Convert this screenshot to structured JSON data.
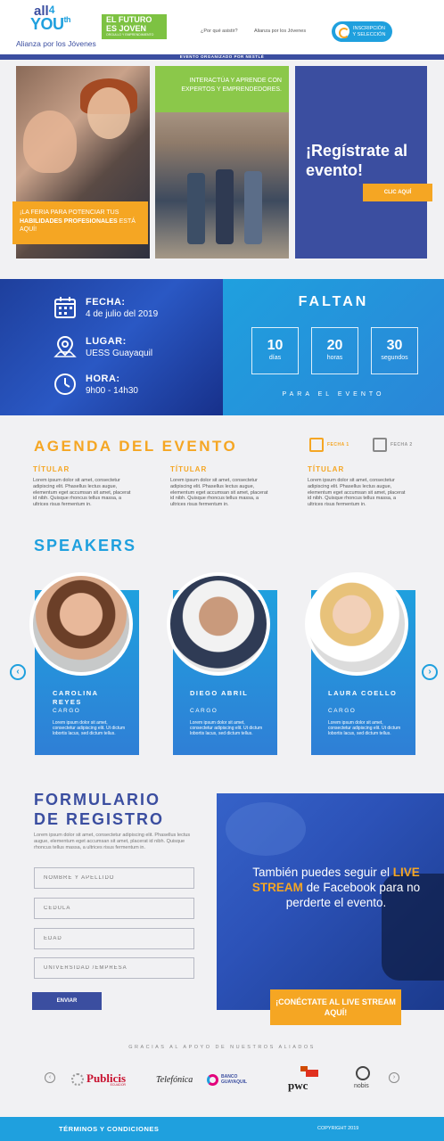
{
  "header": {
    "logo_all": "all",
    "logo_4": "4",
    "logo_you": "YOU",
    "logo_th": "th",
    "logo_tagline": "Alianza por los Jóvenes",
    "efej_line1": "EL FUTURO",
    "efej_line2": "ES JOVEN",
    "efej_line3": "ORGULLO Y EMPRENDIMIENTO",
    "nav": [
      "¿Por qué asistir?",
      "Alianza por los Jóvenes"
    ],
    "cta_label": "INSCRIPCIÓN Y SELECCIÓN",
    "topbar_text": "EVENTO ORGANIZADO POR NESTLÉ"
  },
  "hero": {
    "orange_text_pre": "¡LA FERIA PARA POTENCIAR TUS ",
    "orange_text_bold": "HABILIDADES PROFESIONALES",
    "orange_text_post": " ESTÁ AQUÍ!",
    "green_text": "INTERACTÚA Y APRENDE CON EXPERTOS Y EMPRENDEDORES.",
    "register_title": "¡Regístrate al evento!",
    "register_button": "CLIC AQUÍ"
  },
  "event_info": {
    "fecha_label": "FECHA:",
    "fecha_value": "4 de julio del 2019",
    "lugar_label": "LUGAR:",
    "lugar_value": "UESS Guayaquil",
    "hora_label": "HORA:",
    "hora_value": "9h00 - 14h30"
  },
  "countdown": {
    "title": "FALTAN",
    "units": [
      {
        "value": "10",
        "label": "días"
      },
      {
        "value": "20",
        "label": "horas"
      },
      {
        "value": "30",
        "label": "segundos"
      }
    ],
    "subtitle": "PARA EL EVENTO"
  },
  "agenda": {
    "title": "AGENDA DEL EVENTO",
    "tabs": [
      "FECHA 1",
      "FECHA 2"
    ],
    "columns": [
      {
        "heading": "TÍTULAR",
        "text": "Lorem ipsum dolor sit amet, consectetur adipiscing elit. Phasellus lectus augue, elementum eget accumsan sit amet, placerat id nibh. Quisque rhoncus tellus massa, a ultrices risus fermentum in."
      },
      {
        "heading": "TÍTULAR",
        "text": "Lorem ipsum dolor sit amet, consectetur adipiscing elit. Phasellus lectus augue, elementum eget accumsan sit amet, placerat id nibh. Quisque rhoncus tellus massa, a ultrices risus fermentum in."
      },
      {
        "heading": "TÍTULAR",
        "text": "Lorem ipsum dolor sit amet, consectetur adipiscing elit. Phasellus lectus augue, elementum eget accumsan sit amet, placerat id nibh. Quisque rhoncus tellus massa, a ultrices risus fermentum in."
      }
    ]
  },
  "speakers": {
    "title": "SPEAKERS",
    "items": [
      {
        "name": "CAROLINA REYES",
        "cargo": "CARGO",
        "desc": "Lorem ipsum dolor sit amet, consectetur adipiscing elit. Ut dictum lobortis lacus, sed dictum tellus."
      },
      {
        "name": "DIEGO ABRIL",
        "cargo": "CARGO",
        "desc": "Lorem ipsum dolor sit amet, consectetur adipiscing elit. Ut dictum lobortis lacus, sed dictum tellus."
      },
      {
        "name": "LAURA COELLO",
        "cargo": "CARGO",
        "desc": "Lorem ipsum dolor sit amet, consectetur adipiscing elit. Ut dictum lobortis lacus, sed dictum tellus."
      }
    ]
  },
  "form": {
    "title_line1": "FORMULARIO",
    "title_line2": "DE REGISTRO",
    "desc": "Lorem ipsum dolor sit amet, consectetur adipiscing elit. Phasellus lectus augue, elementum eget accumsan sit amet, placerat id nibh. Quisque rhoncus tellus massa, a ultrices risus fermentum in.",
    "fields": [
      "NOMBRE Y APELLIDO",
      "CÉDULA",
      "EDAD",
      "UNIVERSIDAD /EMPRESA"
    ],
    "submit": "ENVIAR"
  },
  "live": {
    "text_pre": "También puedes seguir el ",
    "text_hl": "LIVE STREAM",
    "text_post": " de Facebook para no perderte el evento.",
    "button": "¡CONÉCTATE AL LIVE STREAM AQUÍ!"
  },
  "sponsors": {
    "title": "GRACIAS AL APOYO DE NUESTROS ALIADOS",
    "logos": [
      "Publicis",
      "ECUADOR",
      "Telefónica",
      "BANCO",
      "GUAYAQUIL",
      "pwc",
      "nobis"
    ]
  },
  "footer": {
    "terms": "TÉRMINOS Y CONDICIONES",
    "copyright": "COPYRIGHT 2019"
  },
  "colors": {
    "orange": "#f5a623",
    "blue_dark": "#3b4ea0",
    "blue_light": "#1fa0de",
    "green": "#8bc84a"
  }
}
